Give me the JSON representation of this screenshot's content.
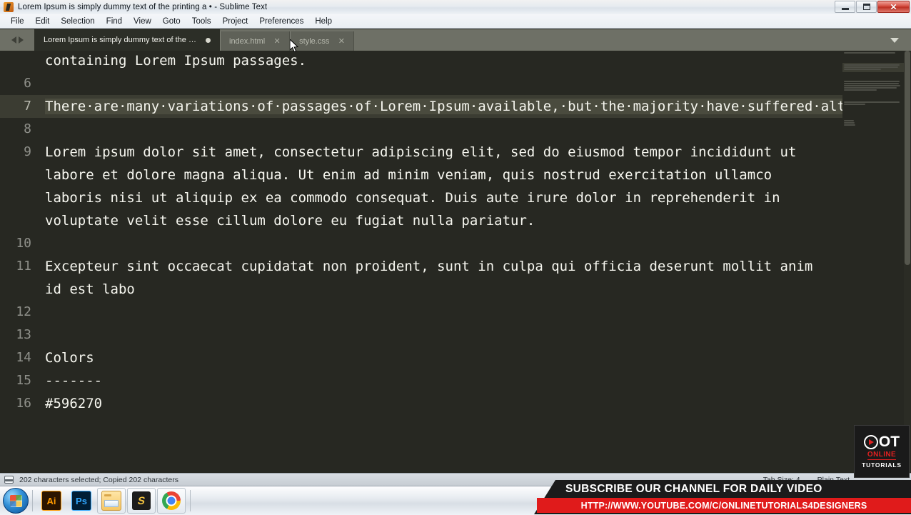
{
  "window": {
    "title": "Lorem Ipsum is simply dummy text of the printing a • - Sublime Text",
    "app_icon": "sublime-text-icon",
    "minimize_label": "Minimize",
    "restore_label": "Restore",
    "close_label": "Close"
  },
  "menubar": {
    "items": [
      {
        "label": "File"
      },
      {
        "label": "Edit"
      },
      {
        "label": "Selection"
      },
      {
        "label": "Find"
      },
      {
        "label": "View"
      },
      {
        "label": "Goto"
      },
      {
        "label": "Tools"
      },
      {
        "label": "Project"
      },
      {
        "label": "Preferences"
      },
      {
        "label": "Help"
      }
    ]
  },
  "tabbar": {
    "back_label": "Back",
    "forward_label": "Forward",
    "menu_icon": "chevron-down-icon",
    "tabs": [
      {
        "label": "Lorem Ipsum is simply dummy text of the printing a",
        "active": true,
        "dirty": true,
        "close": ""
      },
      {
        "label": "index.html",
        "active": false,
        "dirty": false,
        "close": "✕"
      },
      {
        "label": "style.css",
        "active": false,
        "dirty": false,
        "close": "✕"
      }
    ]
  },
  "editor": {
    "theme_bg": "#272822",
    "selection_bg": "#4a4b3e",
    "active_line_bg": "#3b3c32",
    "lines": [
      {
        "number": "",
        "selected": false,
        "text": "containing Lorem Ipsum passages."
      },
      {
        "number": "6",
        "selected": false,
        "text": ""
      },
      {
        "number": "7",
        "selected": true,
        "text": "There·are·many·variations·of·passages·of·Lorem·Ipsum·available,·but·the·majority·have·suffered·alteration·in·some·form,·by·injected·humour,·or·randomised·words·which·don't·look·even·slightly·believable."
      },
      {
        "number": "8",
        "selected": false,
        "text": ""
      },
      {
        "number": "9",
        "selected": false,
        "text": "Lorem ipsum dolor sit amet, consectetur adipiscing elit, sed do eiusmod tempor incididunt ut labore et dolore magna aliqua. Ut enim ad minim veniam, quis nostrud exercitation ullamco laboris nisi ut aliquip ex ea commodo consequat. Duis aute irure dolor in reprehenderit in voluptate velit esse cillum dolore eu fugiat nulla pariatur."
      },
      {
        "number": "10",
        "selected": false,
        "text": ""
      },
      {
        "number": "11",
        "selected": false,
        "text": "Excepteur sint occaecat cupidatat non proident, sunt in culpa qui officia deserunt mollit anim id est labo"
      },
      {
        "number": "12",
        "selected": false,
        "text": ""
      },
      {
        "number": "13",
        "selected": false,
        "text": ""
      },
      {
        "number": "14",
        "selected": false,
        "text": "Colors"
      },
      {
        "number": "15",
        "selected": false,
        "text": "-------"
      },
      {
        "number": "16",
        "selected": false,
        "text": "#596270"
      }
    ]
  },
  "statusbar": {
    "panel_icon": "side-panel-icon",
    "message": "202 characters selected; Copied 202 characters",
    "tab_size": "Tab Size: 4",
    "syntax": "Plain Text"
  },
  "taskbar": {
    "start_label": "Start",
    "items": [
      {
        "name": "illustrator",
        "label": "Ai"
      },
      {
        "name": "photoshop",
        "label": "Ps"
      },
      {
        "name": "file-explorer",
        "label": ""
      },
      {
        "name": "sublime-text",
        "label": "S"
      },
      {
        "name": "google-chrome",
        "label": ""
      }
    ]
  },
  "watermark": {
    "logo_letters": "OT",
    "logo_online": "ONLINE",
    "logo_tutorials": "TUTORIALS",
    "play_icon": "play-icon"
  },
  "promo": {
    "headline": "SUBSCRIBE OUR CHANNEL FOR DAILY VIDEO",
    "url": "HTTP://WWW.YOUTUBE.COM/C/ONLINETUTORIALS4DESIGNERS",
    "bar_color": "#e01b1b"
  },
  "pointer": {
    "icon": "mouse-cursor-icon",
    "x": "406",
    "y": "55"
  }
}
